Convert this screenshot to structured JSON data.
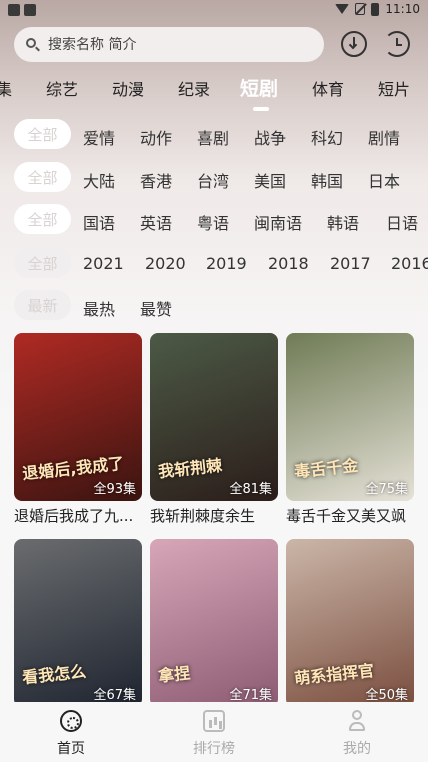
{
  "status_bar": {
    "time": "11:10"
  },
  "search": {
    "placeholder": "搜索名称 简介"
  },
  "tabs": [
    {
      "label": "集"
    },
    {
      "label": "综艺"
    },
    {
      "label": "动漫"
    },
    {
      "label": "纪录"
    },
    {
      "label": "短剧",
      "active": true
    },
    {
      "label": "体育"
    },
    {
      "label": "短片"
    }
  ],
  "filters": {
    "genre": {
      "all": "全部",
      "options": [
        "爱情",
        "动作",
        "喜剧",
        "战争",
        "科幻",
        "剧情"
      ]
    },
    "region": {
      "all": "全部",
      "options": [
        "大陆",
        "香港",
        "台湾",
        "美国",
        "韩国",
        "日本"
      ]
    },
    "language": {
      "all": "全部",
      "options": [
        "国语",
        "英语",
        "粤语",
        "闽南语",
        "韩语",
        "日语"
      ]
    },
    "year": {
      "all": "全部",
      "options": [
        "2021",
        "2020",
        "2019",
        "2018",
        "2017",
        "2016"
      ]
    },
    "sort": {
      "all": "最新",
      "options": [
        "最热",
        "最赞"
      ]
    }
  },
  "cards": [
    {
      "title": "退婚后我成了九...",
      "episodes": "全93集",
      "poster_text": "退婚后,我成了",
      "colors": [
        "#b02a24",
        "#3a1410"
      ]
    },
    {
      "title": "我斩荆棘度余生",
      "episodes": "全81集",
      "poster_text": "我斩荆棘",
      "colors": [
        "#4c5a46",
        "#2b1d1a"
      ]
    },
    {
      "title": "毒舌千金又美又飒",
      "episodes": "全75集",
      "poster_text": "毒舌千金",
      "colors": [
        "#6f7b55",
        "#e6e2d8"
      ]
    },
    {
      "title": "",
      "episodes": "全67集",
      "poster_text": "看我怎么",
      "colors": [
        "#6a6c6e",
        "#1e2430"
      ]
    },
    {
      "title": "",
      "episodes": "全71集",
      "poster_text": "拿捏",
      "colors": [
        "#d7a7b8",
        "#8c5b73"
      ]
    },
    {
      "title": "",
      "episodes": "全50集",
      "poster_text": "萌系指挥官",
      "colors": [
        "#cbb6a8",
        "#7a4d3e"
      ]
    }
  ],
  "bottom_nav": [
    {
      "label": "首页",
      "icon": "film-icon",
      "active": true
    },
    {
      "label": "排行榜",
      "icon": "ranking-icon"
    },
    {
      "label": "我的",
      "icon": "user-icon"
    }
  ]
}
